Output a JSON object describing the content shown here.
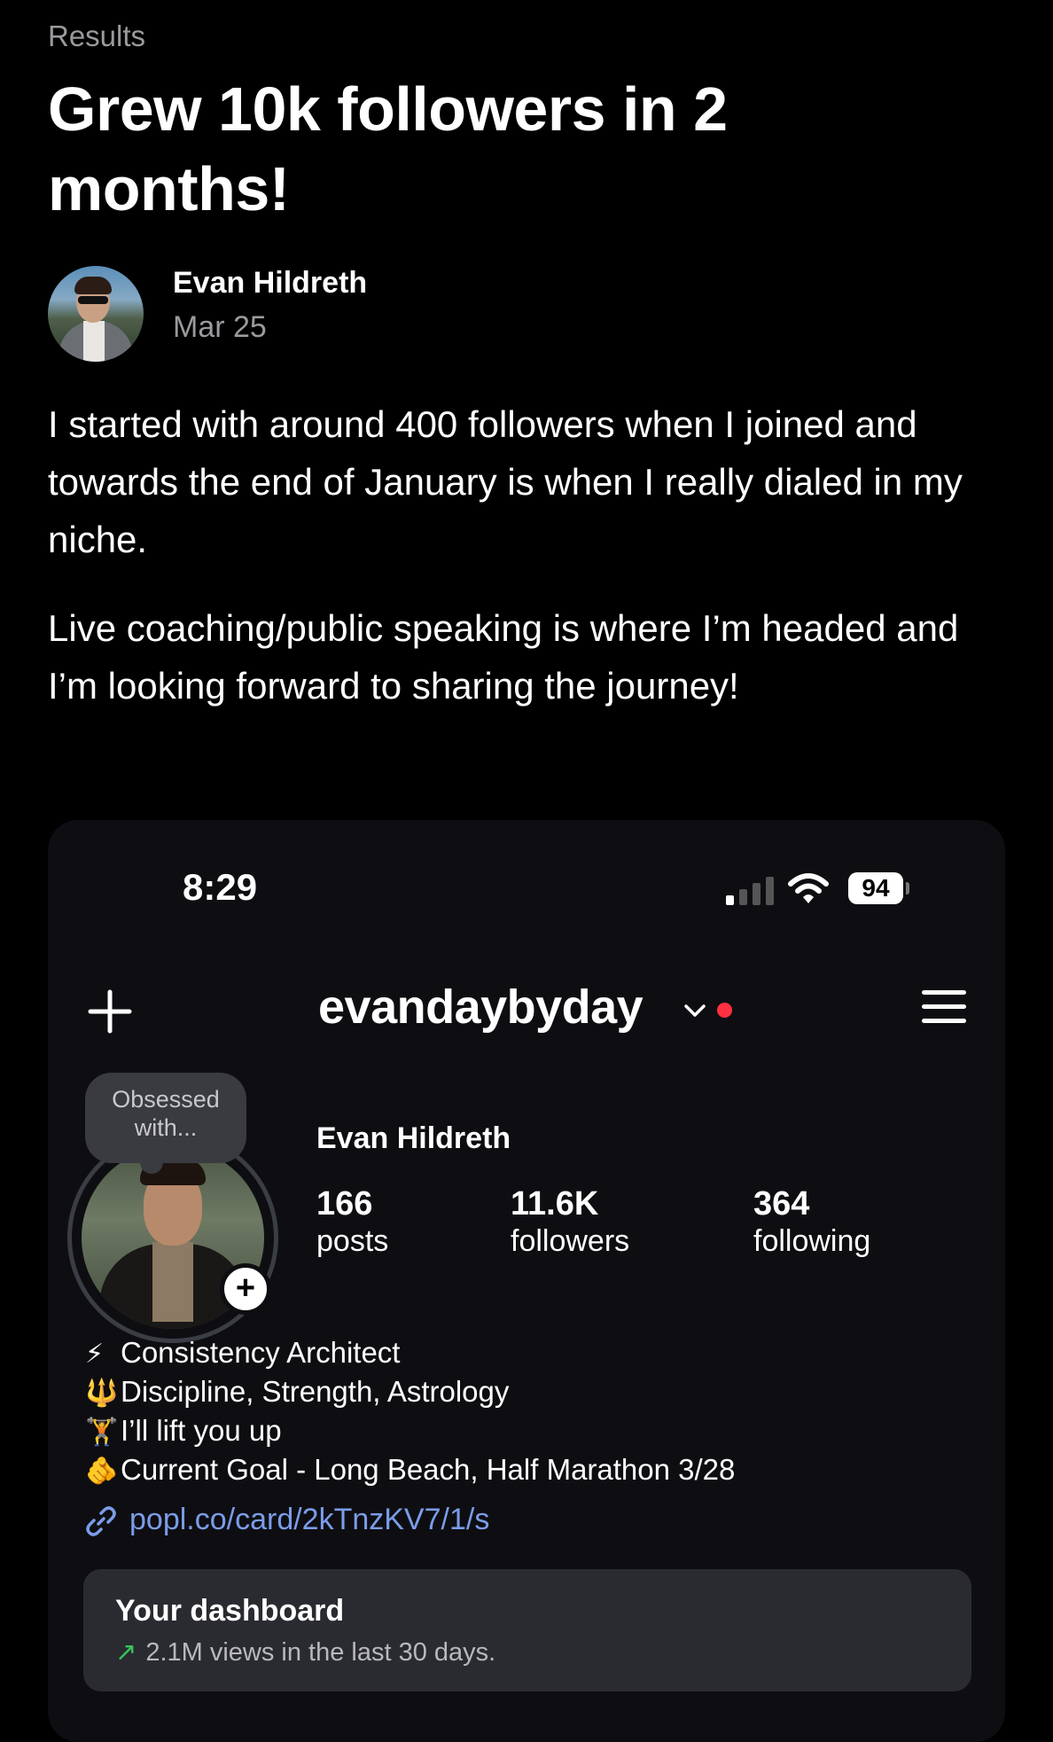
{
  "post": {
    "category": "Results",
    "title": "Grew 10k followers in 2 months!",
    "author": "Evan Hildreth",
    "date": "Mar 25",
    "paragraphs": [
      "I started with around 400 followers when I joined and towards the end of January is when I really dialed in my niche.",
      "Live coaching/public speaking is where I’m headed and I’m looking forward to sharing the journey!"
    ]
  },
  "screenshot": {
    "status_bar": {
      "time": "8:29",
      "battery": "94"
    },
    "header": {
      "username": "evandaybyday"
    },
    "profile": {
      "note": "Obsessed with...",
      "add_story": "+",
      "name": "Evan Hildreth",
      "stats": [
        {
          "count": "166",
          "label": "posts"
        },
        {
          "count": "11.6K",
          "label": "followers"
        },
        {
          "count": "364",
          "label": "following"
        }
      ],
      "bio": [
        {
          "emoji": "⚡",
          "text": "Consistency Architect"
        },
        {
          "emoji": "🔱",
          "text": "Discipline, Strength, Astrology"
        },
        {
          "emoji": "🏋",
          "text": "I’ll lift you up"
        },
        {
          "emoji": "🫵",
          "text": "Current Goal - Long Beach, Half Marathon 3/28"
        }
      ],
      "link": "popl.co/card/2kTnzKV7/1/s"
    },
    "dashboard": {
      "title": "Your dashboard",
      "trend_icon": "↗",
      "subtitle": "2.1M views in the last 30 days."
    }
  },
  "icons": {
    "new_post": "plus-icon",
    "account_switcher": "chevron-down-icon",
    "menu": "hamburger-menu-icon",
    "link": "link-icon",
    "signal": "signal-icon",
    "wifi": "wifi-icon",
    "battery": "battery-icon"
  },
  "colors": {
    "background": "#000000",
    "card_background": "#0e0e12",
    "muted_text": "#9a9a9e",
    "link": "#7b9ce8",
    "notification_dot": "#ff3040",
    "trend": "#34c759"
  }
}
